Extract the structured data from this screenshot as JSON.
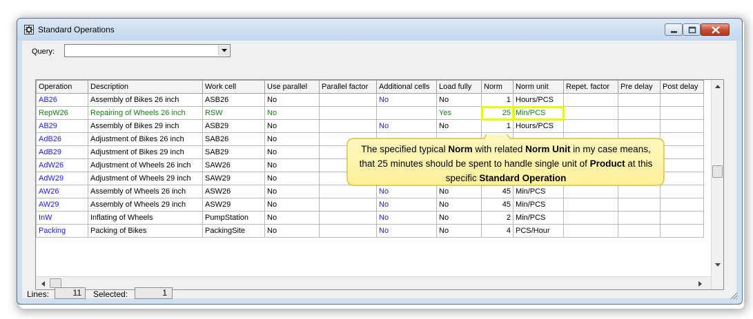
{
  "window": {
    "title": "Standard Operations",
    "icon": "gear-icon",
    "controls": [
      "minimize-icon",
      "maximize-icon",
      "close-icon"
    ]
  },
  "query": {
    "label": "Query:",
    "value": ""
  },
  "table": {
    "columns": [
      "Operation",
      "Description",
      "Work cell",
      "Use parallel",
      "Parallel factor",
      "Additional cells",
      "Load fully",
      "Norm",
      "Norm unit",
      "Repet. factor",
      "Pre delay",
      "Post delay"
    ],
    "rows": [
      {
        "operation": "AB26",
        "description": "Assembly of Bikes 26 inch",
        "work_cell": "ASB26",
        "use_parallel": "No",
        "parallel_factor": "",
        "additional_cells": "No",
        "load_fully": "No",
        "norm": "1",
        "norm_unit": "Hours/PCS",
        "repet_factor": "",
        "pre_delay": "",
        "post_delay": "",
        "style": "normal"
      },
      {
        "operation": "RepW26",
        "description": "Repairing of Wheels 26 inch",
        "work_cell": "RSW",
        "use_parallel": "No",
        "parallel_factor": "",
        "additional_cells": "",
        "load_fully": "Yes",
        "norm": "25",
        "norm_unit": "Min/PCS",
        "repet_factor": "",
        "pre_delay": "",
        "post_delay": "",
        "style": "green"
      },
      {
        "operation": "AB29",
        "description": "Assembly of Bikes 29 inch",
        "work_cell": "ASB29",
        "use_parallel": "No",
        "parallel_factor": "",
        "additional_cells": "No",
        "load_fully": "No",
        "norm": "1",
        "norm_unit": "Hours/PCS",
        "repet_factor": "",
        "pre_delay": "",
        "post_delay": "",
        "style": "normal"
      },
      {
        "operation": "AdB26",
        "description": "Adjustment of Bikes 26 inch",
        "work_cell": "SAB26",
        "use_parallel": "No",
        "parallel_factor": "",
        "additional_cells": "",
        "load_fully": "",
        "norm": "",
        "norm_unit": "",
        "repet_factor": "",
        "pre_delay": "",
        "post_delay": "",
        "style": "normal"
      },
      {
        "operation": "AdB29",
        "description": "Adjustment of Bikes 29 inch",
        "work_cell": "SAB29",
        "use_parallel": "No",
        "parallel_factor": "",
        "additional_cells": "",
        "load_fully": "",
        "norm": "",
        "norm_unit": "",
        "repet_factor": "",
        "pre_delay": "",
        "post_delay": "",
        "style": "normal"
      },
      {
        "operation": "AdW26",
        "description": "Adjustment of Wheels 26 inch",
        "work_cell": "SAW26",
        "use_parallel": "No",
        "parallel_factor": "",
        "additional_cells": "",
        "load_fully": "",
        "norm": "",
        "norm_unit": "",
        "repet_factor": "",
        "pre_delay": "",
        "post_delay": "",
        "style": "normal"
      },
      {
        "operation": "AdW29",
        "description": "Adjustment of Wheels 29 inch",
        "work_cell": "SAW29",
        "use_parallel": "No",
        "parallel_factor": "",
        "additional_cells": "",
        "load_fully": "",
        "norm": "",
        "norm_unit": "",
        "repet_factor": "",
        "pre_delay": "",
        "post_delay": "",
        "style": "normal"
      },
      {
        "operation": "AW26",
        "description": "Assembly of Wheels 26 inch",
        "work_cell": "ASW26",
        "use_parallel": "No",
        "parallel_factor": "",
        "additional_cells": "No",
        "load_fully": "No",
        "norm": "45",
        "norm_unit": "Min/PCS",
        "repet_factor": "",
        "pre_delay": "",
        "post_delay": "",
        "style": "normal"
      },
      {
        "operation": "AW29",
        "description": "Assembly of Wheels 29 inch",
        "work_cell": "ASW29",
        "use_parallel": "No",
        "parallel_factor": "",
        "additional_cells": "No",
        "load_fully": "No",
        "norm": "45",
        "norm_unit": "Min/PCS",
        "repet_factor": "",
        "pre_delay": "",
        "post_delay": "",
        "style": "normal"
      },
      {
        "operation": "InW",
        "description": "Inflating of Wheels",
        "work_cell": "PumpStation",
        "use_parallel": "No",
        "parallel_factor": "",
        "additional_cells": "No",
        "load_fully": "No",
        "norm": "2",
        "norm_unit": "Min/PCS",
        "repet_factor": "",
        "pre_delay": "",
        "post_delay": "",
        "style": "normal"
      },
      {
        "operation": "Packing",
        "description": "Packing of Bikes",
        "work_cell": "PackingSite",
        "use_parallel": "No",
        "parallel_factor": "",
        "additional_cells": "No",
        "load_fully": "No",
        "norm": "4",
        "norm_unit": "PCS/Hour",
        "repet_factor": "",
        "pre_delay": "",
        "post_delay": "",
        "style": "normal"
      }
    ]
  },
  "status": {
    "lines_label": "Lines:",
    "lines_value": "11",
    "selected_label": "Selected:",
    "selected_value": "1"
  },
  "callout": {
    "parts": [
      {
        "text": "The specified typical ",
        "bold": false
      },
      {
        "text": "Norm",
        "bold": true
      },
      {
        "text": " with related ",
        "bold": false
      },
      {
        "text": "Norm Unit",
        "bold": true
      },
      {
        "text": " in my case means, that 25 minutes should be spent to handle single unit of ",
        "bold": false
      },
      {
        "text": "Product",
        "bold": true
      },
      {
        "text": " at this specific ",
        "bold": false
      },
      {
        "text": "Standard Operation",
        "bold": true
      }
    ]
  },
  "colors": {
    "link_blue": "#1a1aff",
    "selected_green": "#148214",
    "highlight": "#e6ff00",
    "callout_fill": "#fff7a8",
    "callout_border": "#d7c83c"
  }
}
